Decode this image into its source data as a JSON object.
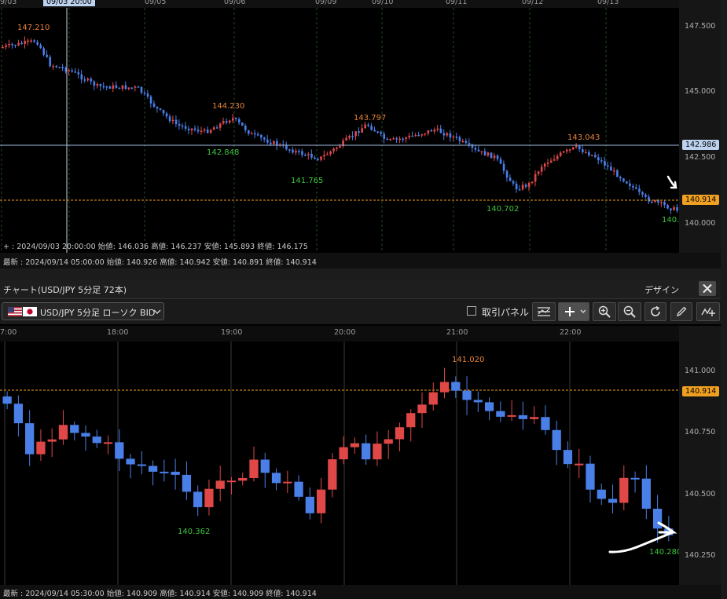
{
  "top_chart": {
    "date_labels": [
      "9/03",
      "09/03 20:00",
      "09/05",
      "09/06",
      "09/09",
      "09/10",
      "09/11",
      "09/12",
      "09/13"
    ],
    "price_labels": [
      "147.500",
      "145.000",
      "142.500",
      "140.000"
    ],
    "crosshair_price": "142.986",
    "current_price": "140.914",
    "annotations_high": [
      "147.210",
      "144.230",
      "143.797",
      "143.043"
    ],
    "annotations_low": [
      "142.848",
      "141.765",
      "140.702",
      "140."
    ],
    "crosshair_info": "+ : 2024/09/03 20:00:00  始値: 146.036  高値: 146.237  安値: 145.893  終値: 146.175",
    "latest_info": "最新 : 2024/09/14 05:00:00  始値: 140.926  高値: 140.942  安値: 140.891  終値: 140.914"
  },
  "panel": {
    "title": "チャート(USD/JPY 5分足 72本)",
    "design_label": "デザイン",
    "symbol_selector": "USD/JPY 5分足 ローソク BID",
    "trade_panel_label": "取引パネル"
  },
  "bottom_chart": {
    "time_labels": [
      "7:00",
      "18:00",
      "19:00",
      "20:00",
      "21:00",
      "22:00"
    ],
    "price_labels": [
      "141.000",
      "140.750",
      "140.500",
      "140.250"
    ],
    "current_price": "140.914",
    "annotations_high": [
      "141.020"
    ],
    "annotations_low": [
      "140.362",
      "140.280"
    ],
    "latest_info": "最新 : 2024/09/14 05:30:00  始値: 140.909  高値: 140.914  安値: 140.909  終値: 140.914"
  },
  "colors": {
    "up": "#e04848",
    "down": "#4a7fe8",
    "high_label": "#e8823a",
    "low_label": "#3fc43f",
    "current_line": "#f0a020",
    "crosshair_line": "#9fb8e0"
  },
  "icons": [
    "us-flag-icon",
    "jp-flag-icon",
    "chevron-down-icon",
    "gear-icon",
    "close-icon",
    "indicator-list-icon",
    "crosshair-icon",
    "zoom-in-icon",
    "zoom-out-icon",
    "refresh-icon",
    "pen-icon",
    "chart-tools-icon"
  ]
}
